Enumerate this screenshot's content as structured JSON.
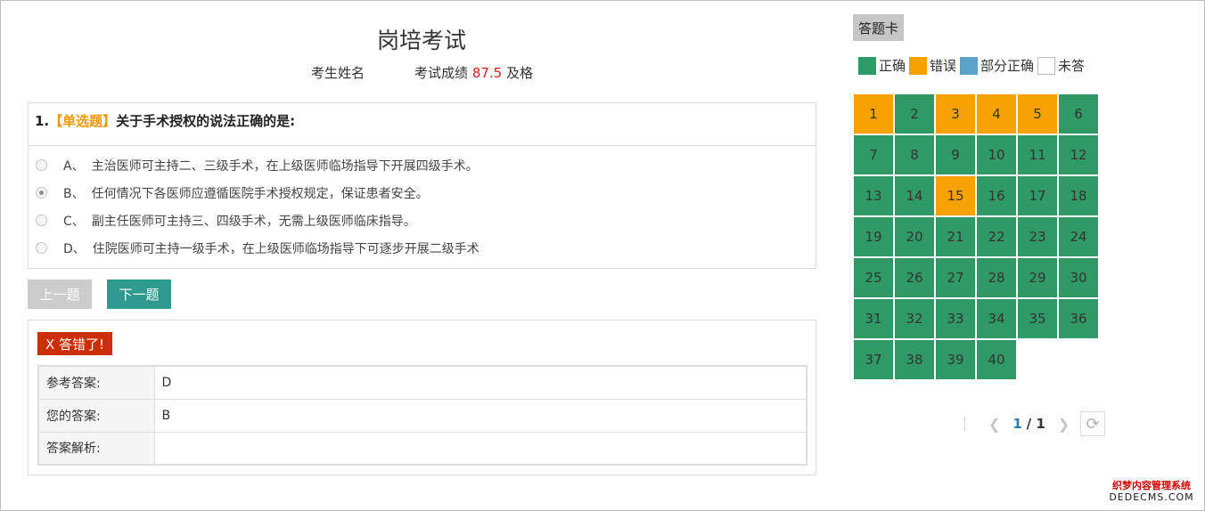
{
  "header": {
    "title": "岗培考试",
    "candidate_label": "考生姓名",
    "score_label": "考试成绩",
    "score_value": "87.5",
    "pass_status": "及格"
  },
  "question": {
    "number": "1.",
    "type_tag": "【单选题】",
    "text": "关于手术授权的说法正确的是:",
    "options": [
      {
        "letter": "A、",
        "text": "主治医师可主持二、三级手术，在上级医师临场指导下开展四级手术。",
        "selected": false
      },
      {
        "letter": "B、",
        "text": "任何情况下各医师应遵循医院手术授权规定，保证患者安全。",
        "selected": true
      },
      {
        "letter": "C、",
        "text": "副主任医师可主持三、四级手术，无需上级医师临床指导。",
        "selected": false
      },
      {
        "letter": "D、",
        "text": "住院医师可主持一级手术，在上级医师临场指导下可逐步开展二级手术",
        "selected": false
      }
    ]
  },
  "nav": {
    "prev_label": "上一题",
    "next_label": "下一题"
  },
  "result": {
    "badge": "X 答错了!",
    "rows": [
      {
        "key": "参考答案:",
        "value": "D"
      },
      {
        "key": "您的答案:",
        "value": "B"
      },
      {
        "key": "答案解析:",
        "value": ""
      }
    ]
  },
  "answer_card": {
    "tab_label": "答题卡",
    "legend": [
      {
        "label": "正确",
        "color": "#2f9a65"
      },
      {
        "label": "错误",
        "color": "#f7a200"
      },
      {
        "label": "部分正确",
        "color": "#5ba3c9"
      },
      {
        "label": "未答",
        "color": "#ffffff"
      }
    ],
    "colors": {
      "correct": "#2f9a65",
      "wrong": "#f7a200"
    },
    "cells": [
      {
        "n": "1",
        "status": "wrong"
      },
      {
        "n": "2",
        "status": "correct"
      },
      {
        "n": "3",
        "status": "wrong"
      },
      {
        "n": "4",
        "status": "wrong"
      },
      {
        "n": "5",
        "status": "wrong"
      },
      {
        "n": "6",
        "status": "correct"
      },
      {
        "n": "7",
        "status": "correct"
      },
      {
        "n": "8",
        "status": "correct"
      },
      {
        "n": "9",
        "status": "correct"
      },
      {
        "n": "10",
        "status": "correct"
      },
      {
        "n": "11",
        "status": "correct"
      },
      {
        "n": "12",
        "status": "correct"
      },
      {
        "n": "13",
        "status": "correct"
      },
      {
        "n": "14",
        "status": "correct"
      },
      {
        "n": "15",
        "status": "wrong"
      },
      {
        "n": "16",
        "status": "correct"
      },
      {
        "n": "17",
        "status": "correct"
      },
      {
        "n": "18",
        "status": "correct"
      },
      {
        "n": "19",
        "status": "correct"
      },
      {
        "n": "20",
        "status": "correct"
      },
      {
        "n": "21",
        "status": "correct"
      },
      {
        "n": "22",
        "status": "correct"
      },
      {
        "n": "23",
        "status": "correct"
      },
      {
        "n": "24",
        "status": "correct"
      },
      {
        "n": "25",
        "status": "correct"
      },
      {
        "n": "26",
        "status": "correct"
      },
      {
        "n": "27",
        "status": "correct"
      },
      {
        "n": "28",
        "status": "correct"
      },
      {
        "n": "29",
        "status": "correct"
      },
      {
        "n": "30",
        "status": "correct"
      },
      {
        "n": "31",
        "status": "correct"
      },
      {
        "n": "32",
        "status": "correct"
      },
      {
        "n": "33",
        "status": "correct"
      },
      {
        "n": "34",
        "status": "correct"
      },
      {
        "n": "35",
        "status": "correct"
      },
      {
        "n": "36",
        "status": "correct"
      },
      {
        "n": "37",
        "status": "correct"
      },
      {
        "n": "38",
        "status": "correct"
      },
      {
        "n": "39",
        "status": "correct"
      },
      {
        "n": "40",
        "status": "correct"
      }
    ]
  },
  "pager": {
    "prev_icon": "chevron-left-icon",
    "current": "1",
    "total": "/ 1",
    "next_icon": "chevron-right-icon",
    "refresh_icon": "refresh-icon"
  },
  "watermark": {
    "line1": "织梦内容管理系统",
    "line2": "DEDECMS.COM"
  }
}
